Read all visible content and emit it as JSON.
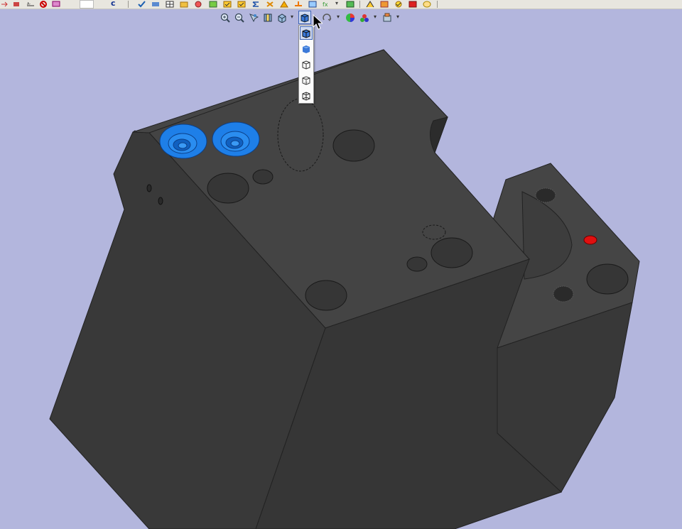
{
  "app": {
    "viewport_background": "#b3b6dd",
    "model_color": "#3b3b3b",
    "highlight_color": "#1e7fe8",
    "marker_color": "#e01010"
  },
  "top_toolbar": {
    "c_label": "c",
    "icons": [
      "arrow-icon",
      "cross-icon",
      "no-icon",
      "chart-icon",
      "check-icon",
      "measure-icon",
      "tool-icon",
      "sphere-icon",
      "link-icon",
      "box-check-icon",
      "box-check-icon",
      "sum-icon",
      "cut-icon",
      "warn-icon",
      "arrow-up-icon",
      "grid-icon",
      "extract-icon",
      "flag-icon",
      "param-icon",
      "param2-icon",
      "check-icon",
      "stop-icon",
      "paint-icon"
    ]
  },
  "view_toolbar": {
    "zoom_in": "zoom-in-icon",
    "zoom_out": "zoom-out-icon",
    "pan": "pan-icon",
    "views": "views-icon",
    "standard_views": "standard-views-icon",
    "display_mode": "display-mode-icon",
    "rotate": "rotate-icon",
    "appearance": "appearance-icon",
    "scene": "scene-icon",
    "render": "render-icon"
  },
  "display_menu": {
    "items": [
      {
        "name": "shaded-with-edges",
        "selected": true
      },
      {
        "name": "shaded",
        "selected": false
      },
      {
        "name": "hidden-lines-removed",
        "selected": false
      },
      {
        "name": "hidden-lines-visible",
        "selected": false
      },
      {
        "name": "wireframe",
        "selected": false
      }
    ]
  }
}
